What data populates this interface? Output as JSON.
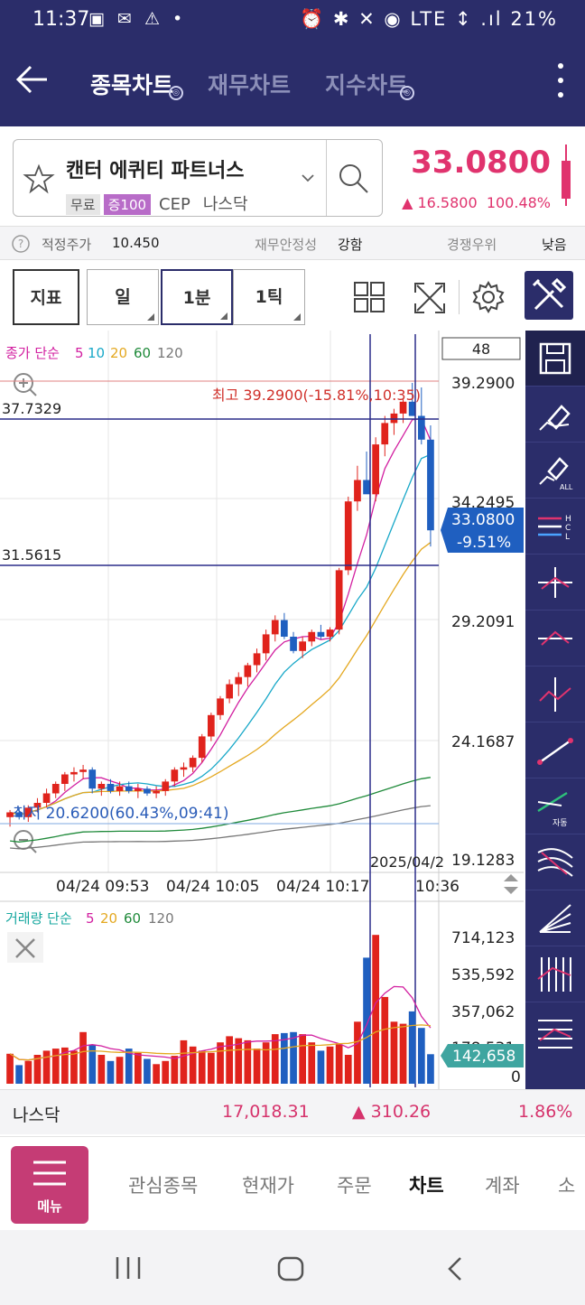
{
  "status_bar": {
    "time": "11:37",
    "left_icons": "▣ ✉ ⚠ •",
    "right_icons": "⏰ ✱ ✕ ◉ LTE ↕ .ıl",
    "battery": "21%"
  },
  "app_bar": {
    "tabs": [
      {
        "label": "종목차트",
        "active": true
      },
      {
        "label": "재무차트",
        "active": false
      },
      {
        "label": "지수차트",
        "active": false
      }
    ]
  },
  "stock": {
    "name": "캔터 에퀴티 파트너스",
    "tag_free": "무료",
    "tag_margin": "증100",
    "ticker": "CEP",
    "exchange": "나스닥",
    "price": "33.0800",
    "change_abs": "▲ 16.5800",
    "change_pct": "100.48%"
  },
  "info_bar": {
    "fair_price_label": "적정주가",
    "fair_price_value": "10.450",
    "fin_stability_label": "재무안정성",
    "fin_stability_value": "강함",
    "competitive_label": "경쟁우위",
    "competitive_value": "낮음"
  },
  "toolbar": {
    "indicator_label": "지표",
    "period_day": "일",
    "period_min": "1분",
    "period_tick": "1틱"
  },
  "chart": {
    "legend_prefix": "종가 단순",
    "ma_periods": [
      "5",
      "10",
      "20",
      "60",
      "120"
    ],
    "ma_colors": [
      "#d21fa0",
      "#18a8c8",
      "#e4a820",
      "#1f8a3a",
      "#777777"
    ],
    "candle_count": "48",
    "hline_high_label": "37.7329",
    "hline_low_label": "31.5615",
    "max_annotation": "최고 39.2900(-15.81%,10:35)",
    "min_annotation": "최저 20.6200(60.43%,09:41)",
    "y_ticks": [
      "39.2900",
      "34.2495",
      "29.2091",
      "24.1687",
      "19.1283"
    ],
    "current_price": "33.0800",
    "current_pct": "-9.51%",
    "x_label_1": "04/24 09:53",
    "x_label_2": "04/24 10:05",
    "x_label_3": "04/24 10:17",
    "x_label_4": "10:36",
    "x_overlap_label": "2025/04/2",
    "volume_legend_prefix": "거래량 단순",
    "volume_periods": [
      "5",
      "20",
      "60",
      "120"
    ],
    "volume_ticks": [
      "714,123",
      "535,592",
      "357,062",
      "178,531",
      "0"
    ],
    "volume_current": "142,658"
  },
  "chart_data": {
    "type": "candlestick",
    "ylim": [
      19.1283,
      39.29
    ],
    "candles": [
      [
        21.0,
        21.3,
        20.6,
        21.2
      ],
      [
        21.2,
        21.4,
        20.9,
        21.0
      ],
      [
        21.0,
        21.5,
        20.8,
        21.4
      ],
      [
        21.4,
        21.8,
        21.2,
        21.6
      ],
      [
        21.6,
        22.2,
        21.4,
        22.0
      ],
      [
        22.0,
        22.5,
        21.8,
        22.4
      ],
      [
        22.4,
        22.9,
        22.1,
        22.8
      ],
      [
        22.8,
        23.1,
        22.5,
        22.9
      ],
      [
        22.9,
        23.2,
        22.6,
        23.0
      ],
      [
        23.0,
        23.1,
        22.0,
        22.2
      ],
      [
        22.2,
        22.5,
        21.9,
        22.4
      ],
      [
        22.4,
        22.6,
        22.0,
        22.1
      ],
      [
        22.1,
        22.5,
        21.9,
        22.3
      ],
      [
        22.3,
        22.5,
        22.0,
        22.1
      ],
      [
        22.1,
        22.4,
        21.8,
        22.2
      ],
      [
        22.2,
        22.3,
        21.9,
        22.0
      ],
      [
        22.0,
        22.3,
        21.8,
        22.1
      ],
      [
        22.1,
        22.6,
        21.9,
        22.5
      ],
      [
        22.5,
        23.1,
        22.3,
        23.0
      ],
      [
        23.0,
        23.3,
        22.7,
        23.1
      ],
      [
        23.1,
        23.6,
        22.9,
        23.5
      ],
      [
        23.5,
        24.5,
        23.3,
        24.4
      ],
      [
        24.4,
        25.4,
        24.2,
        25.3
      ],
      [
        25.3,
        26.1,
        25.1,
        26.0
      ],
      [
        26.0,
        26.8,
        25.8,
        26.6
      ],
      [
        26.6,
        27.1,
        26.1,
        26.9
      ],
      [
        26.9,
        27.5,
        26.5,
        27.4
      ],
      [
        27.4,
        28.1,
        27.1,
        27.9
      ],
      [
        27.9,
        28.9,
        27.6,
        28.7
      ],
      [
        28.7,
        29.5,
        28.4,
        29.3
      ],
      [
        29.3,
        29.6,
        28.5,
        28.6
      ],
      [
        28.6,
        28.8,
        27.9,
        28.0
      ],
      [
        28.0,
        28.6,
        27.7,
        28.4
      ],
      [
        28.4,
        28.9,
        28.2,
        28.8
      ],
      [
        28.8,
        29.1,
        28.5,
        28.6
      ],
      [
        28.6,
        29.0,
        28.4,
        28.9
      ],
      [
        28.9,
        31.5,
        28.7,
        31.4
      ],
      [
        31.4,
        34.5,
        31.2,
        34.3
      ],
      [
        34.3,
        35.8,
        33.9,
        35.2
      ],
      [
        35.2,
        36.4,
        34.8,
        34.6
      ],
      [
        34.6,
        37.0,
        34.3,
        36.7
      ],
      [
        36.7,
        37.9,
        36.2,
        37.6
      ],
      [
        37.6,
        38.2,
        37.1,
        38.0
      ],
      [
        38.0,
        38.6,
        37.6,
        38.5
      ],
      [
        38.5,
        39.29,
        37.9,
        37.9
      ],
      [
        37.9,
        39.1,
        36.7,
        36.9
      ],
      [
        36.9,
        37.5,
        32.4,
        33.08
      ]
    ],
    "volume": [
      145000,
      90000,
      110000,
      140000,
      160000,
      170000,
      175000,
      160000,
      250000,
      190000,
      140000,
      110000,
      130000,
      170000,
      150000,
      120000,
      95000,
      110000,
      135000,
      210000,
      180000,
      160000,
      150000,
      200000,
      230000,
      220000,
      210000,
      170000,
      200000,
      240000,
      245000,
      250000,
      240000,
      200000,
      160000,
      180000,
      190000,
      140000,
      300000,
      610000,
      720000,
      420000,
      300000,
      290000,
      350000,
      270000,
      142658
    ]
  },
  "index_strip": {
    "name": "나스닥",
    "value": "17,018.31",
    "change": "▲ 310.26",
    "pct": "1.86%"
  },
  "nav": {
    "menu_label": "메뉴",
    "items": [
      {
        "label": "관심종목",
        "active": false
      },
      {
        "label": "현재가",
        "active": false
      },
      {
        "label": "주문",
        "active": false
      },
      {
        "label": "차트",
        "active": true
      },
      {
        "label": "계좌",
        "active": false
      },
      {
        "label": "소",
        "active": false
      }
    ]
  }
}
